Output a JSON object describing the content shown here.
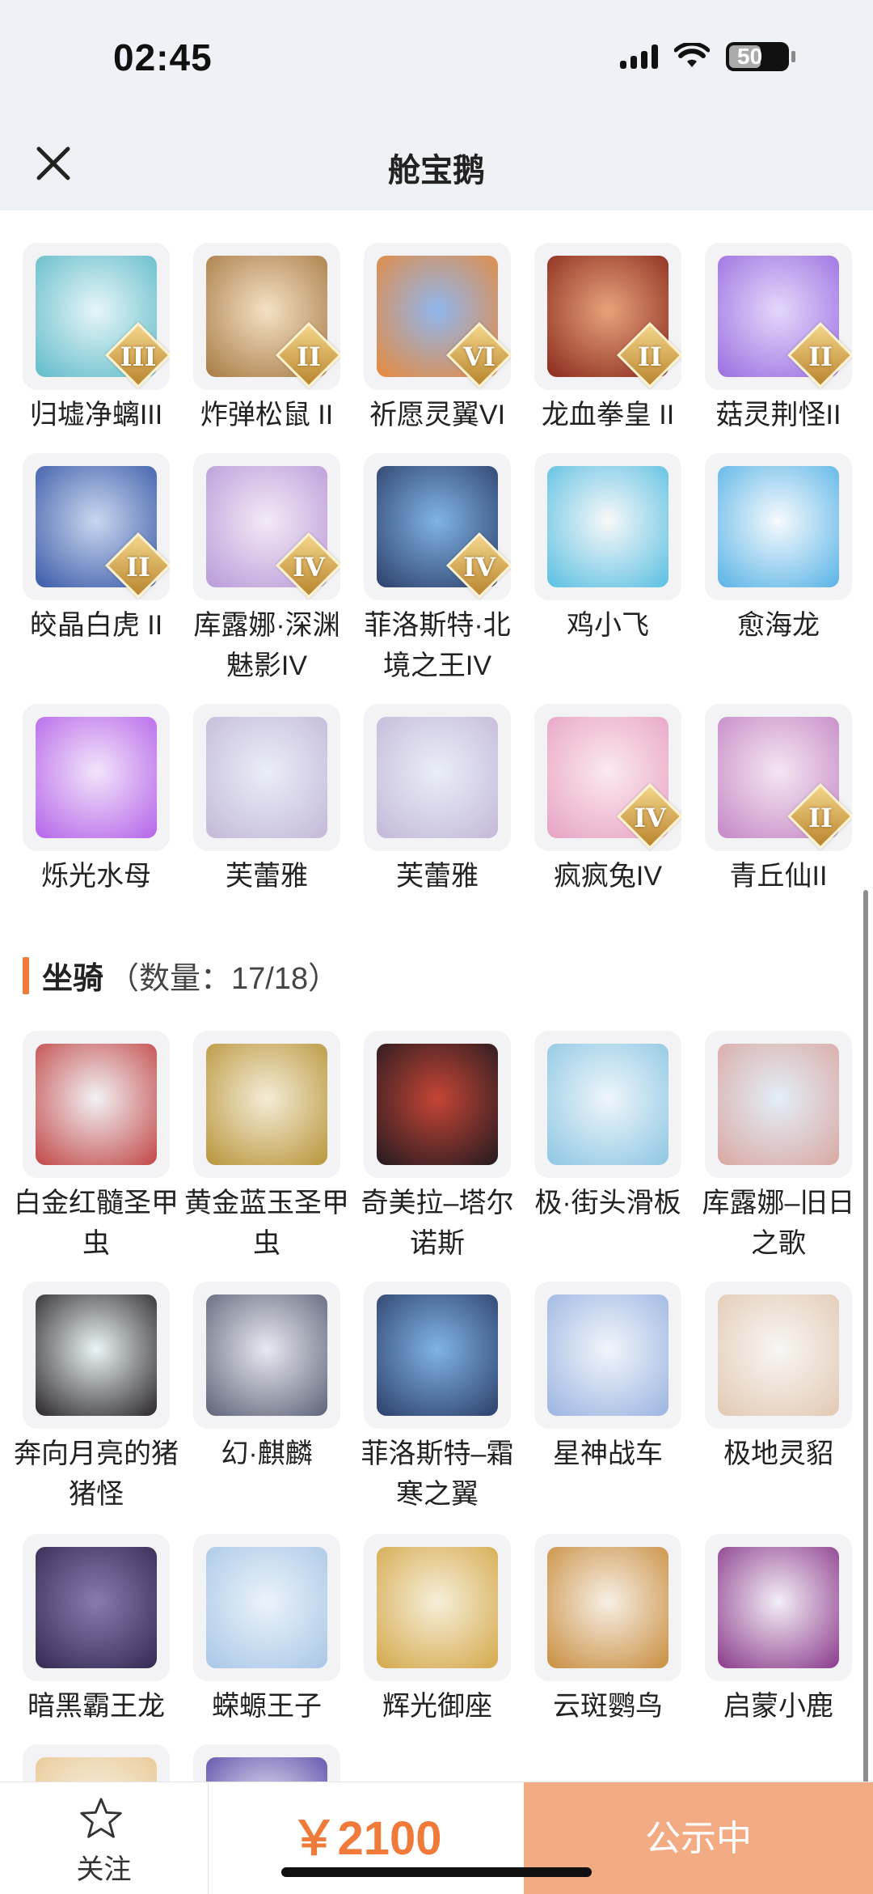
{
  "status_bar": {
    "time": "02:45",
    "battery": "50"
  },
  "nav": {
    "title": "舱宝鹅"
  },
  "pets": [
    {
      "label": "归墟净螭III",
      "badge": "III",
      "colors": [
        "#e6f6f8",
        "#5fbac8"
      ]
    },
    {
      "label": "炸弹松鼠 II",
      "badge": "II",
      "colors": [
        "#f3e1c4",
        "#a87a44"
      ]
    },
    {
      "label": "祈愿灵翼VI",
      "badge": "VI",
      "colors": [
        "#8fb6ee",
        "#e8893a"
      ]
    },
    {
      "label": "龙血拳皇 II",
      "badge": "II",
      "colors": [
        "#e7a37c",
        "#8a2a1c"
      ]
    },
    {
      "label": "菇灵荆怪II",
      "badge": "II",
      "colors": [
        "#e4d8fb",
        "#9a6ee0"
      ]
    },
    {
      "label": "皎晶白虎 II",
      "badge": "II",
      "colors": [
        "#c9d7ef",
        "#3a5aa8"
      ]
    },
    {
      "label": "库露娜·深渊魅影IV",
      "badge": "IV",
      "colors": [
        "#f3eaf6",
        "#b89ad8"
      ]
    },
    {
      "label": "菲洛斯特·北境之王IV",
      "badge": "IV",
      "colors": [
        "#7fb4e4",
        "#2d3f6a"
      ]
    },
    {
      "label": "鸡小飞",
      "badge": "",
      "colors": [
        "#f8f8f8",
        "#59bfe2"
      ]
    },
    {
      "label": "愈海龙",
      "badge": "",
      "colors": [
        "#f6fafd",
        "#58b3e6"
      ]
    },
    {
      "label": "烁光水母",
      "badge": "",
      "colors": [
        "#f2e4fb",
        "#b564e9"
      ]
    },
    {
      "label": "芙蕾雅",
      "badge": "",
      "colors": [
        "#e9eef8",
        "#c4b8d8"
      ]
    },
    {
      "label": "芙蕾雅",
      "badge": "",
      "colors": [
        "#e9eef8",
        "#c4b8d8"
      ]
    },
    {
      "label": "疯疯兔IV",
      "badge": "IV",
      "colors": [
        "#fbe9f1",
        "#e7a2c2"
      ]
    },
    {
      "label": "青丘仙II",
      "badge": "II",
      "colors": [
        "#f5e6f1",
        "#c488c6"
      ]
    }
  ],
  "mounts_section": {
    "title": "坐骑",
    "count": "（数量：17/18）"
  },
  "mounts": [
    {
      "label": "白金红髓圣甲虫",
      "badge": "",
      "colors": [
        "#f2f2f4",
        "#c24646"
      ]
    },
    {
      "label": "黄金蓝玉圣甲虫",
      "badge": "",
      "colors": [
        "#f4ecd6",
        "#b8953a"
      ]
    },
    {
      "label": "奇美拉–塔尔诺斯",
      "badge": "",
      "colors": [
        "#c54535",
        "#241a20"
      ]
    },
    {
      "label": "极·街头滑板",
      "badge": "",
      "colors": [
        "#eef6fb",
        "#8dc6e2"
      ]
    },
    {
      "label": "库露娜–旧日之歌",
      "badge": "",
      "colors": [
        "#e3eef8",
        "#d9a8a2"
      ]
    },
    {
      "label": "奔向月亮的猪猪怪",
      "badge": "",
      "colors": [
        "#eaf4f6",
        "#2a2528"
      ]
    },
    {
      "label": "幻·麒麟",
      "badge": "",
      "colors": [
        "#e7e9f0",
        "#5e6378"
      ]
    },
    {
      "label": "菲洛斯特–霜寒之翼",
      "badge": "",
      "colors": [
        "#7fb4e4",
        "#2d3f6a"
      ]
    },
    {
      "label": "星神战车",
      "badge": "",
      "colors": [
        "#f1f5fb",
        "#9bb4e0"
      ]
    },
    {
      "label": "极地灵貂",
      "badge": "",
      "colors": [
        "#f8f6f4",
        "#e2c9b2"
      ]
    },
    {
      "label": "暗黑霸王龙",
      "badge": "",
      "colors": [
        "#8a7ab0",
        "#352a52"
      ]
    },
    {
      "label": "蝾螈王子",
      "badge": "",
      "colors": [
        "#eaf3fa",
        "#a9c7e6"
      ]
    },
    {
      "label": "辉光御座",
      "badge": "",
      "colors": [
        "#f6efd9",
        "#d4a84a"
      ]
    },
    {
      "label": "云斑鹦鸟",
      "badge": "",
      "colors": [
        "#f7efe4",
        "#c88d3e"
      ]
    },
    {
      "label": "启蒙小鹿",
      "badge": "",
      "colors": [
        "#f3eef6",
        "#8a3a8a"
      ]
    },
    {
      "label": "",
      "badge": "",
      "colors": [
        "#f8f2e6",
        "#e8c894"
      ]
    },
    {
      "label": "",
      "badge": "",
      "colors": [
        "#eceaf6",
        "#5a4aa8"
      ]
    }
  ],
  "bottom": {
    "follow_label": "关注",
    "price": "￥2100",
    "status_label": "公示中"
  },
  "colors": {
    "accent": "#f07a3a",
    "button_bg": "#f3ab84",
    "header_bg": "#eef1f5"
  }
}
